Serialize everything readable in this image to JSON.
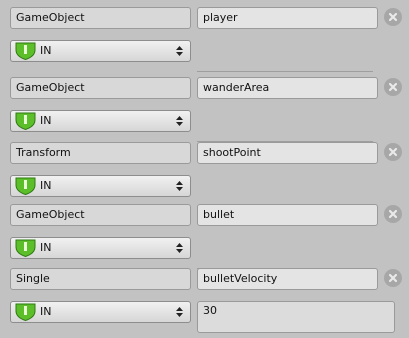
{
  "variables": [
    {
      "type": "GameObject",
      "name": "player",
      "direction": "IN",
      "value": null
    },
    {
      "type": "GameObject",
      "name": "wanderArea",
      "direction": "IN",
      "value": null
    },
    {
      "type": "Transform",
      "name": "shootPoint",
      "direction": "IN",
      "value": null
    },
    {
      "type": "GameObject",
      "name": "bullet",
      "direction": "IN",
      "value": null
    },
    {
      "type": "Single",
      "name": "bulletVelocity",
      "direction": "IN",
      "value": "30"
    }
  ],
  "icons": {
    "remove": "close-circle-icon",
    "direction": "green-shield-icon",
    "select": "up-down-arrows-icon"
  },
  "colors": {
    "background": "#c2c2c2",
    "remove_button": "#a7a7a7",
    "direction_icon": "#5cbf2a"
  }
}
